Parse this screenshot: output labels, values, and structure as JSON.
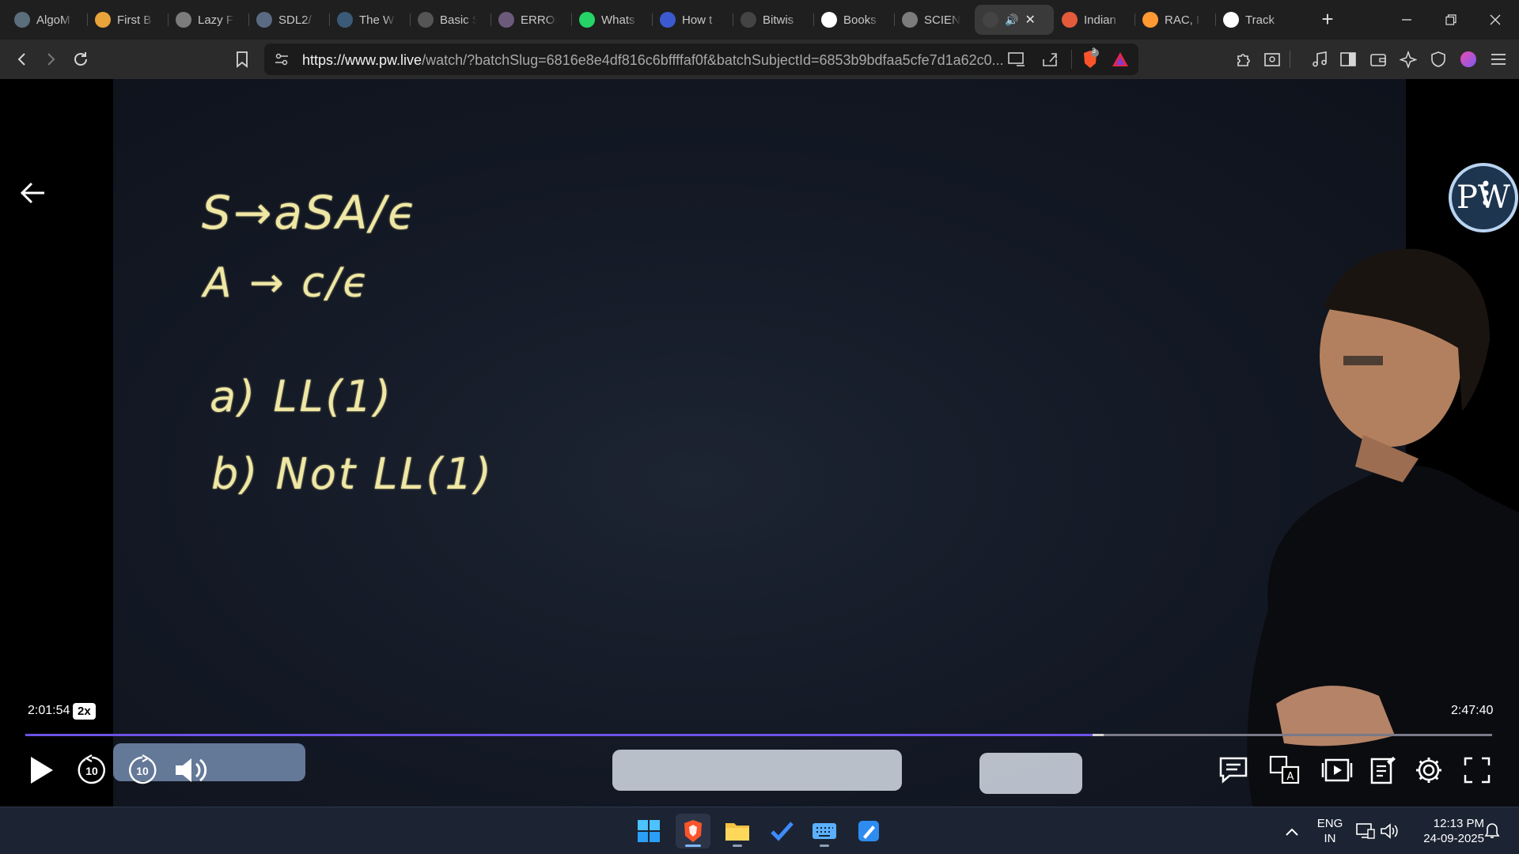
{
  "browser": {
    "tabs": [
      {
        "title": "AlgoM",
        "icon": "algo-icon",
        "color": "#5b6e7c"
      },
      {
        "title": "First B",
        "icon": "lightning-icon",
        "color": "#e8a33a"
      },
      {
        "title": "Lazy F",
        "icon": "globe-icon",
        "color": "#7c7c7c"
      },
      {
        "title": "SDL2/",
        "icon": "sdl-icon",
        "color": "#5a6a82"
      },
      {
        "title": "The W",
        "icon": "wordpress-icon",
        "color": "#3b5a78"
      },
      {
        "title": "Basic S",
        "icon": "code-icon",
        "color": "#555555"
      },
      {
        "title": "ERROI",
        "icon": "error-icon",
        "color": "#6c5a7a"
      },
      {
        "title": "Whats",
        "icon": "whatsapp-icon",
        "color": "#25d366"
      },
      {
        "title": "How t",
        "icon": "how-icon",
        "color": "#3c5ad0"
      },
      {
        "title": "Bitwis",
        "icon": "bitwise-icon",
        "color": "#444444"
      },
      {
        "title": "Books",
        "icon": "google-icon",
        "color": "#ffffff"
      },
      {
        "title": "SCIEN",
        "icon": "globe-icon",
        "color": "#7c7c7c"
      },
      {
        "title": "",
        "icon": "pw-tab-icon",
        "color": "#444444",
        "active": true
      },
      {
        "title": "Indian",
        "icon": "indian-icon",
        "color": "#e35b3a"
      },
      {
        "title": "RAC, I",
        "icon": "india-flag-icon",
        "color": "#ff9933"
      },
      {
        "title": "Track",
        "icon": "amazon-icon",
        "color": "#ffffff"
      }
    ],
    "url_host": "https://www.pw.live",
    "url_rest": "/watch/?batchSlug=6816e8e4df816c6bffffaf0f&batchSubjectId=6853b9bdfaa5cfe7d1a62c0...",
    "brave_badge": "3"
  },
  "video": {
    "board_lines": [
      "S→aSA/ϵ",
      "A → c/ϵ",
      "a) LL(1)",
      "b) Not LL(1)"
    ],
    "logo_text": "PW",
    "current_time": "2:01:54",
    "speed": "2x",
    "duration": "2:47:40",
    "progress_fraction": 0.7275,
    "buffered_fraction": 0.735,
    "skip_back_label": "10",
    "skip_forward_label": "10"
  },
  "taskbar": {
    "lang_line1": "ENG",
    "lang_line2": "IN",
    "time": "12:13 PM",
    "date": "24-09-2025"
  },
  "colors": {
    "accent_progress": "#6e52e8",
    "chalk": "#efe7a4",
    "taskbar": "#1c2433"
  }
}
